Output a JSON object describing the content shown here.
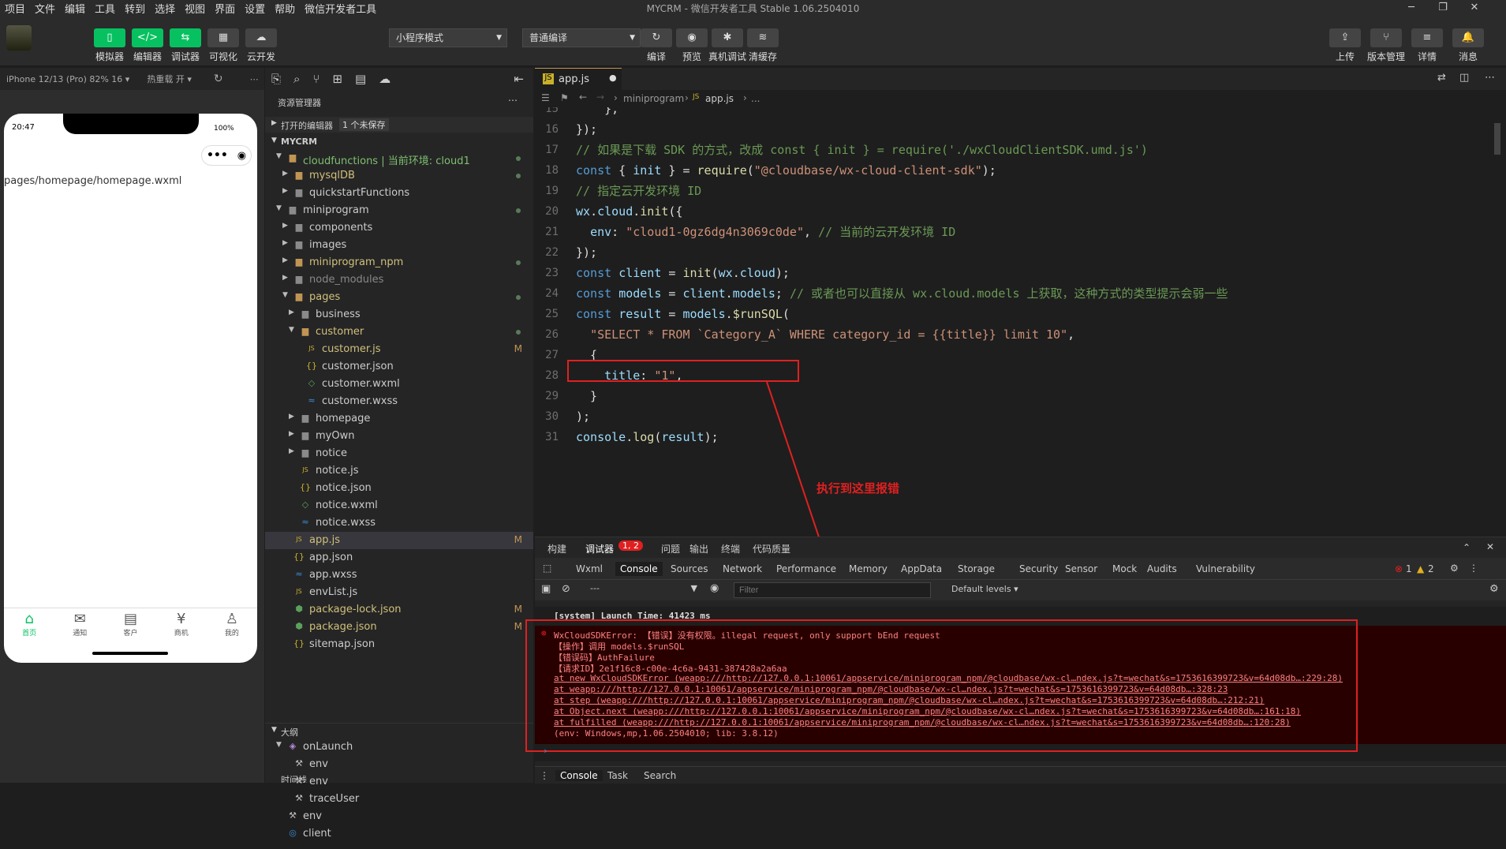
{
  "menu": [
    "项目",
    "文件",
    "编辑",
    "工具",
    "转到",
    "选择",
    "视图",
    "界面",
    "设置",
    "帮助",
    "微信开发者工具"
  ],
  "app_title": "MYCRM - 微信开发者工具 Stable 1.06.2504010",
  "toolbar": {
    "left": [
      {
        "icon": "phone-icon",
        "label": "模拟器"
      },
      {
        "icon": "code-icon",
        "label": "编辑器"
      },
      {
        "icon": "debug-icon",
        "label": "调试器"
      },
      {
        "icon": "visual-icon",
        "label": "可视化"
      },
      {
        "icon": "cloud-icon",
        "label": "云开发"
      }
    ],
    "mode_select": "小程序模式",
    "compile_select": "普通编译",
    "mid": [
      {
        "icon": "refresh-icon",
        "label": "编译"
      },
      {
        "icon": "eye-icon",
        "label": "预览"
      },
      {
        "icon": "bug-icon",
        "label": "真机调试"
      },
      {
        "icon": "layers-icon",
        "label": "清缓存"
      }
    ],
    "right": [
      {
        "icon": "upload-icon",
        "label": "上传"
      },
      {
        "icon": "branch-icon",
        "label": "版本管理"
      },
      {
        "icon": "menu-icon",
        "label": "详情"
      },
      {
        "icon": "bell-icon",
        "label": "消息"
      }
    ]
  },
  "sim": {
    "device": "iPhone 12/13 (Pro) 82% 16",
    "hotreload": "热重载 开",
    "time": "20:47",
    "battery": "100%",
    "page_path": "pages/homepage/homepage.wxml",
    "tabs": [
      {
        "label": "首页",
        "active": true
      },
      {
        "label": "通知"
      },
      {
        "label": "客户"
      },
      {
        "label": "商机"
      },
      {
        "label": "我的"
      }
    ]
  },
  "explorer": {
    "title": "资源管理器",
    "open_editors": "打开的编辑器",
    "unsaved": "1 个未保存",
    "project": "MYCRM",
    "outline": "大纲",
    "timeline": "时间线"
  },
  "tree": [
    {
      "d": 1,
      "t": "folder",
      "n": "cloudfunctions | 当前环境: cloud1",
      "o": true,
      "g": true,
      "dot": true
    },
    {
      "d": 2,
      "t": "folder",
      "n": "mysqlDB",
      "g": true,
      "dot": true
    },
    {
      "d": 2,
      "t": "folder",
      "n": "quickstartFunctions"
    },
    {
      "d": 1,
      "t": "folder",
      "n": "miniprogram",
      "o": true,
      "dot": true
    },
    {
      "d": 2,
      "t": "folder",
      "n": "components"
    },
    {
      "d": 2,
      "t": "folder",
      "n": "images"
    },
    {
      "d": 2,
      "t": "folder",
      "n": "miniprogram_npm",
      "g": true,
      "dot": true
    },
    {
      "d": 2,
      "t": "folder",
      "n": "node_modules",
      "dim": true
    },
    {
      "d": 2,
      "t": "folder",
      "n": "pages",
      "o": true,
      "g": true,
      "dot": true
    },
    {
      "d": 3,
      "t": "folder",
      "n": "business"
    },
    {
      "d": 3,
      "t": "folder",
      "n": "customer",
      "o": true,
      "g": true,
      "dot": true
    },
    {
      "d": 4,
      "t": "js",
      "n": "customer.js",
      "g": true,
      "badge": "M"
    },
    {
      "d": 4,
      "t": "json",
      "n": "customer.json"
    },
    {
      "d": 4,
      "t": "wxml",
      "n": "customer.wxml"
    },
    {
      "d": 4,
      "t": "wxss",
      "n": "customer.wxss"
    },
    {
      "d": 3,
      "t": "folder",
      "n": "homepage"
    },
    {
      "d": 3,
      "t": "folder",
      "n": "myOwn"
    },
    {
      "d": 3,
      "t": "folder",
      "n": "notice"
    },
    {
      "d": 3,
      "t": "js",
      "n": "notice.js"
    },
    {
      "d": 3,
      "t": "json",
      "n": "notice.json"
    },
    {
      "d": 3,
      "t": "wxml",
      "n": "notice.wxml"
    },
    {
      "d": 3,
      "t": "wxss",
      "n": "notice.wxss"
    },
    {
      "d": 2,
      "t": "js",
      "n": "app.js",
      "g": true,
      "badge": "M",
      "sel": true
    },
    {
      "d": 2,
      "t": "json",
      "n": "app.json"
    },
    {
      "d": 2,
      "t": "wxss",
      "n": "app.wxss"
    },
    {
      "d": 2,
      "t": "js",
      "n": "envList.js"
    },
    {
      "d": 2,
      "t": "pkg",
      "n": "package-lock.json",
      "g": true,
      "badge": "M"
    },
    {
      "d": 2,
      "t": "pkg",
      "n": "package.json",
      "g": true,
      "badge": "M"
    },
    {
      "d": 2,
      "t": "json",
      "n": "sitemap.json"
    }
  ],
  "outline": [
    {
      "d": 1,
      "t": "cube",
      "n": "onLaunch",
      "o": true
    },
    {
      "d": 2,
      "t": "wrench",
      "n": "env"
    },
    {
      "d": 2,
      "t": "wrench",
      "n": "env"
    },
    {
      "d": 2,
      "t": "wrench",
      "n": "traceUser"
    },
    {
      "d": 1,
      "t": "wrench",
      "n": "env"
    },
    {
      "d": 1,
      "t": "obj",
      "n": "client"
    }
  ],
  "editor": {
    "tab": "app.js",
    "crumb": [
      "miniprogram",
      "app.js",
      "..."
    ],
    "lines": [
      {
        "n": "15",
        "h": "    },"
      },
      {
        "n": "16",
        "h": "});"
      },
      {
        "n": "17",
        "h": "<span class=\"cm\">// 如果是下载 SDK 的方式，改成 const { init } = require('./wxCloudClientSDK.umd.js')</span>"
      },
      {
        "n": "18",
        "h": "<span class=\"kw\">const</span> { <span class=\"var\">init</span> } = <span class=\"fn\">require</span>(<span class=\"str\">\"@cloudbase/wx-cloud-client-sdk\"</span>);"
      },
      {
        "n": "19",
        "h": "<span class=\"cm\">// 指定云开发环境 ID</span>"
      },
      {
        "n": "20",
        "h": "<span class=\"var\">wx</span>.<span class=\"var\">cloud</span>.<span class=\"fn\">init</span>({"
      },
      {
        "n": "21",
        "h": "  <span class=\"var\">env</span>: <span class=\"str\">\"cloud1-0gz6dg4n3069c0de\"</span>, <span class=\"cm\">// 当前的云开发环境 ID</span>"
      },
      {
        "n": "22",
        "h": "});"
      },
      {
        "n": "23",
        "h": "<span class=\"kw\">const</span> <span class=\"var\">client</span> = <span class=\"fn\">init</span>(<span class=\"var\">wx</span>.<span class=\"var\">cloud</span>);"
      },
      {
        "n": "24",
        "h": "<span class=\"kw\">const</span> <span class=\"var\">models</span> = <span class=\"var\">client</span>.<span class=\"var\">models</span>; <span class=\"cm\">// 或者也可以直接从 wx.cloud.models 上获取，这种方式的类型提示会弱一些</span>"
      },
      {
        "n": "25",
        "h": "<span class=\"kw\">const</span> <span class=\"var\">result</span> = <span class=\"var\">models</span>.<span class=\"fn\">$runSQL</span>("
      },
      {
        "n": "26",
        "h": "  <span class=\"str\">\"SELECT * FROM `Category_A` WHERE category_id = {{title}} limit 10\"</span>,"
      },
      {
        "n": "27",
        "h": "  {"
      },
      {
        "n": "28",
        "h": "    <span class=\"var\">title</span>: <span class=\"str\">\"1\"</span>,"
      },
      {
        "n": "29",
        "h": "  }"
      },
      {
        "n": "30",
        "h": ");"
      },
      {
        "n": "31",
        "h": "<span class=\"var\">console</span>.<span class=\"fn\">log</span>(<span class=\"var\">result</span>);"
      }
    ]
  },
  "annotation": "执行到这里报错",
  "devtools": {
    "top_tabs": [
      "构建",
      "调试器",
      "问题",
      "输出",
      "终端",
      "代码质量"
    ],
    "badge": "1, 2",
    "panel_tabs": [
      "Wxml",
      "Console",
      "Sources",
      "Network",
      "Performance",
      "Memory",
      "AppData",
      "Storage",
      "Security",
      "Sensor",
      "Mock",
      "Audits",
      "Vulnerability"
    ],
    "errors": "1",
    "warnings": "2",
    "context": "---",
    "filter_placeholder": "Filter",
    "levels": "Default levels",
    "launch": "[system] Launch Time: 41423 ms",
    "err": [
      "WxCloudSDKError: 【错误】没有权限。illegal request, only support bEnd request",
      "【操作】调用 models.$runSQL",
      "【错误码】AuthFailure",
      "【请求ID】2e1f16c8-c00e-4c6a-9431-387428a2a6aa",
      "    at new WxCloudSDKError (weapp:///http://127.0.0.1:10061/appservice/miniprogram_npm/@cloudbase/wx-cl…ndex.js?t=wechat&s=1753616399723&v=64d08db…:229:28)",
      "    at weapp:///http://127.0.0.1:10061/appservice/miniprogram_npm/@cloudbase/wx-cl…ndex.js?t=wechat&s=1753616399723&v=64d08db…:328:23",
      "    at step (weapp:///http://127.0.0.1:10061/appservice/miniprogram_npm/@cloudbase/wx-cl…ndex.js?t=wechat&s=1753616399723&v=64d08db…:212:21)",
      "    at Object.next (weapp:///http://127.0.0.1:10061/appservice/miniprogram_npm/@cloudbase/wx-cl…ndex.js?t=wechat&s=1753616399723&v=64d08db…:161:18)",
      "    at fulfilled (weapp:///http://127.0.0.1:10061/appservice/miniprogram_npm/@cloudbase/wx-cl…ndex.js?t=wechat&s=1753616399723&v=64d08db…:120:28)",
      "(env: Windows,mp,1.06.2504010; lib: 3.8.12)"
    ],
    "bottom_tabs": [
      "Console",
      "Task",
      "Search"
    ]
  },
  "colors": {
    "accent": "#07c160",
    "error": "#e02020",
    "annotation": "#e02020"
  }
}
